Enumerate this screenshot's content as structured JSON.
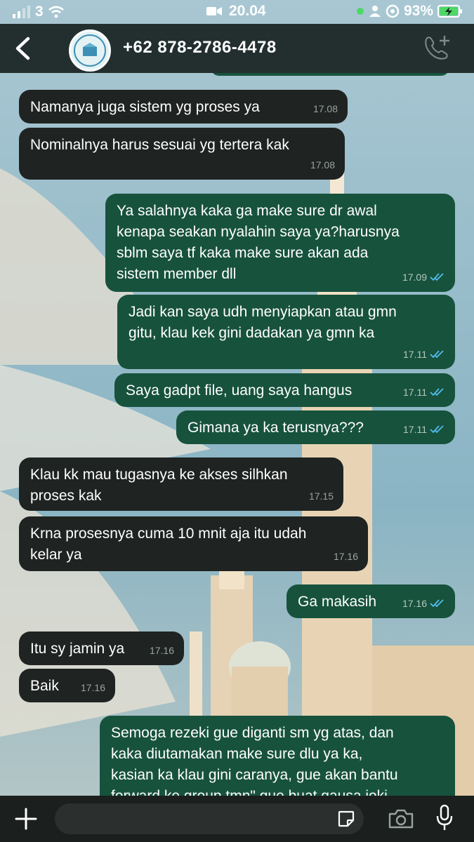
{
  "status_bar": {
    "carrier": "3",
    "time": "20.04",
    "battery": "93%"
  },
  "header": {
    "contact": "+62 878-2786-4478",
    "avatar_icon": "profile-logo-icon"
  },
  "messages": [
    {
      "dir": "in",
      "text": "Namanya juga sistem yg proses ya",
      "time": "17.08"
    },
    {
      "dir": "in",
      "text": "Nominalnya harus sesuai yg tertera kak",
      "time": "17.08"
    },
    {
      "dir": "out",
      "text": "Ya salahnya kaka ga make sure dr awal\nkenapa seakan nyalahin saya ya?harusnya\nsblm saya tf kaka make sure akan ada\nsistem member dll",
      "time": "17.09"
    },
    {
      "dir": "out",
      "text": "Jadi kan saya udh menyiapkan atau gmn\ngitu, klau kek gini dadakan ya gmn ka",
      "time": "17.11"
    },
    {
      "dir": "out",
      "text": "Saya gadpt file, uang saya hangus",
      "time": "17.11"
    },
    {
      "dir": "out",
      "text": "Gimana ya ka terusnya???",
      "time": "17.11"
    },
    {
      "dir": "in",
      "text": "Klau kk mau tugasnya ke akses silhkan\nproses kak",
      "time": "17.15"
    },
    {
      "dir": "in",
      "text": "Krna prosesnya cuma 10 mnit aja itu udah\nkelar ya",
      "time": "17.16"
    },
    {
      "dir": "out",
      "text": "Ga makasih",
      "time": "17.16"
    },
    {
      "dir": "in",
      "text": "Itu sy jamin ya",
      "time": "17.16"
    },
    {
      "dir": "in",
      "text": "Baik",
      "time": "17.16"
    },
    {
      "dir": "out",
      "text": "Semoga rezeki gue diganti sm yg atas, dan\nkaka diutamakan make sure dlu ya ka,\nkasian ka klau gini caranya, gue akan bantu\nforward ke group tmn\" gue buat gausa joki",
      "time": ""
    }
  ],
  "colors": {
    "incoming_bubble": "#1f2322",
    "outgoing_bubble": "#17523d",
    "read_ticks": "#53bdeb",
    "battery_fill": "#4cd964"
  }
}
